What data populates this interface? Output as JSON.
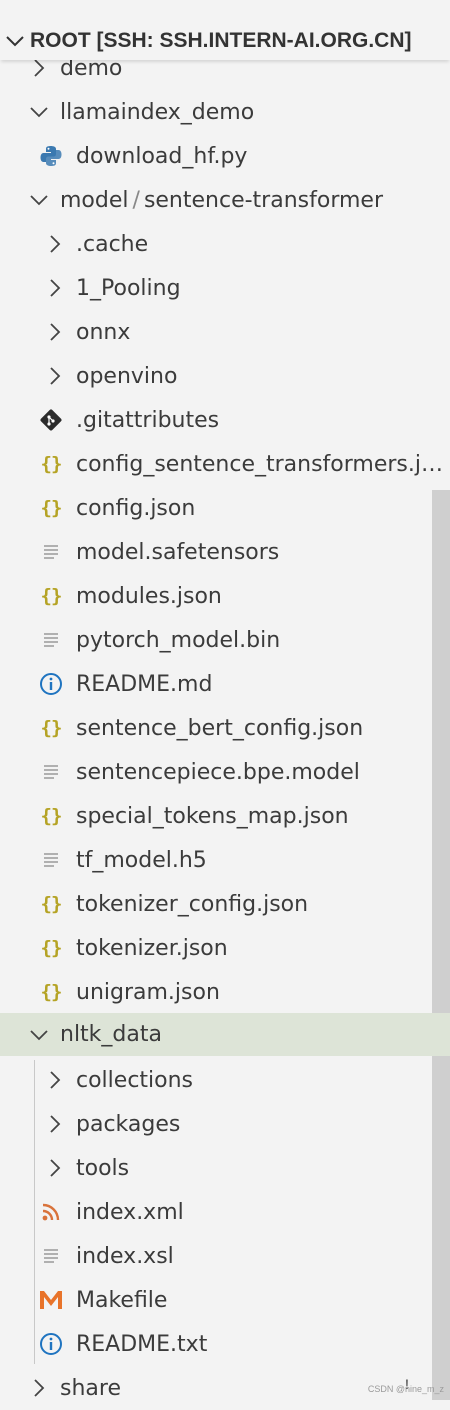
{
  "explorer": {
    "root_label": "ROOT [SSH: SSH.INTERN-AI.ORG.CN]",
    "tree": [
      {
        "label": "demo",
        "kind": "folder",
        "expanded": false
      },
      {
        "label": "llamaindex_demo",
        "kind": "folder",
        "expanded": true
      },
      {
        "label": "download_hf.py",
        "kind": "python-file"
      },
      {
        "label": "model",
        "label2": "sentence-transformer",
        "separator": "/",
        "kind": "folder",
        "expanded": true
      },
      {
        "label": ".cache",
        "kind": "folder",
        "expanded": false
      },
      {
        "label": "1_Pooling",
        "kind": "folder",
        "expanded": false
      },
      {
        "label": "onnx",
        "kind": "folder",
        "expanded": false
      },
      {
        "label": "openvino",
        "kind": "folder",
        "expanded": false
      },
      {
        "label": ".gitattributes",
        "kind": "git-file"
      },
      {
        "label": "config_sentence_transformers.json",
        "kind": "json-file"
      },
      {
        "label": "config.json",
        "kind": "json-file"
      },
      {
        "label": "model.safetensors",
        "kind": "text-file"
      },
      {
        "label": "modules.json",
        "kind": "json-file"
      },
      {
        "label": "pytorch_model.bin",
        "kind": "text-file"
      },
      {
        "label": "README.md",
        "kind": "info-file"
      },
      {
        "label": "sentence_bert_config.json",
        "kind": "json-file"
      },
      {
        "label": "sentencepiece.bpe.model",
        "kind": "text-file"
      },
      {
        "label": "special_tokens_map.json",
        "kind": "json-file"
      },
      {
        "label": "tf_model.h5",
        "kind": "text-file"
      },
      {
        "label": "tokenizer_config.json",
        "kind": "json-file"
      },
      {
        "label": "tokenizer.json",
        "kind": "json-file"
      },
      {
        "label": "unigram.json",
        "kind": "json-file"
      },
      {
        "label": "nltk_data",
        "kind": "folder",
        "expanded": true,
        "selected": true
      },
      {
        "label": "collections",
        "kind": "folder",
        "expanded": false
      },
      {
        "label": "packages",
        "kind": "folder",
        "expanded": false
      },
      {
        "label": "tools",
        "kind": "folder",
        "expanded": false
      },
      {
        "label": "index.xml",
        "kind": "rss-file"
      },
      {
        "label": "index.xsl",
        "kind": "text-file"
      },
      {
        "label": "Makefile",
        "kind": "makefile"
      },
      {
        "label": "README.txt",
        "kind": "info-file"
      },
      {
        "label": "share",
        "kind": "folder",
        "expanded": false
      }
    ]
  },
  "footer": {
    "watermark": "CSDN @nine_m_z",
    "cursor_glyph": "!"
  },
  "colors": {
    "background": "#f3f3f3",
    "selected": "#dde4d7",
    "json_icon": "#b5a325",
    "python_icon": "#3b79b0",
    "info_icon": "#1f74c0",
    "rss_icon": "#d9733b",
    "makefile_icon": "#e8732a",
    "scrollbar": "#cfcfcf"
  }
}
